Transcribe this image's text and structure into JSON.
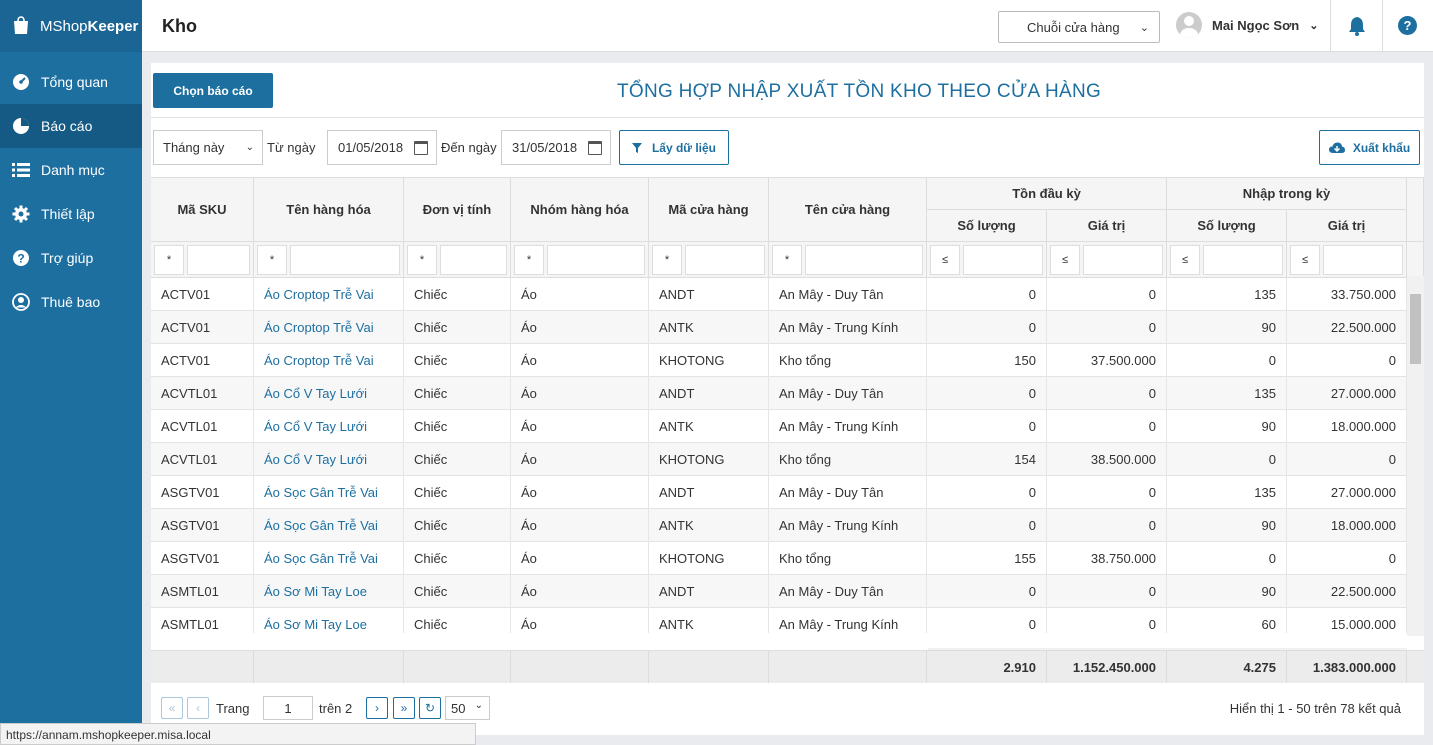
{
  "app": {
    "logo_text": "MShop",
    "logo_bold": "Keeper"
  },
  "sidebar": {
    "items": [
      {
        "label": "Tổng quan",
        "icon": "speedometer-icon"
      },
      {
        "label": "Báo cáo",
        "icon": "pie-chart-icon",
        "active": true
      },
      {
        "label": "Danh mục",
        "icon": "list-icon"
      },
      {
        "label": "Thiết lập",
        "icon": "gear-icon"
      },
      {
        "label": "Trợ giúp",
        "icon": "help-icon"
      },
      {
        "label": "Thuê bao",
        "icon": "user-icon"
      }
    ]
  },
  "header": {
    "title": "Kho",
    "store_select": "Chuỗi cửa hàng",
    "user_name": "Mai Ngọc Sơn"
  },
  "report": {
    "choose_button": "Chọn báo cáo",
    "title": "TỔNG HỢP NHẬP XUẤT TỒN KHO THEO CỬA HÀNG",
    "period": "Tháng này",
    "from_label": "Từ ngày",
    "from_date": "01/05/2018",
    "to_label": "Đến ngày",
    "to_date": "31/05/2018",
    "get_data_button": "Lấy dữ liệu",
    "export_button": "Xuất khẩu"
  },
  "table": {
    "columns": [
      "Mã SKU",
      "Tên hàng hóa",
      "Đơn vị tính",
      "Nhóm hàng hóa",
      "Mã cửa hàng",
      "Tên cửa hàng"
    ],
    "groups": [
      "Tồn đầu kỳ",
      "Nhập trong kỳ"
    ],
    "sub_columns": [
      "Số lượng",
      "Giá trị",
      "Số lượng",
      "Giá trị"
    ],
    "filter_ops": [
      "*",
      "*",
      "*",
      "*",
      "*",
      "*",
      "≤",
      "≤",
      "≤",
      "≤"
    ],
    "rows": [
      [
        "ACTV01",
        "Áo Croptop Trễ Vai",
        "Chiếc",
        "Áo",
        "ANDT",
        "An Mây - Duy Tân",
        "0",
        "0",
        "135",
        "33.750.000"
      ],
      [
        "ACTV01",
        "Áo Croptop Trễ Vai",
        "Chiếc",
        "Áo",
        "ANTK",
        "An Mây - Trung Kính",
        "0",
        "0",
        "90",
        "22.500.000"
      ],
      [
        "ACTV01",
        "Áo Croptop Trễ Vai",
        "Chiếc",
        "Áo",
        "KHOTONG",
        "Kho tổng",
        "150",
        "37.500.000",
        "0",
        "0"
      ],
      [
        "ACVTL01",
        "Áo Cổ V Tay Lưới",
        "Chiếc",
        "Áo",
        "ANDT",
        "An Mây - Duy Tân",
        "0",
        "0",
        "135",
        "27.000.000"
      ],
      [
        "ACVTL01",
        "Áo Cổ V Tay Lưới",
        "Chiếc",
        "Áo",
        "ANTK",
        "An Mây - Trung Kính",
        "0",
        "0",
        "90",
        "18.000.000"
      ],
      [
        "ACVTL01",
        "Áo Cổ V Tay Lưới",
        "Chiếc",
        "Áo",
        "KHOTONG",
        "Kho tổng",
        "154",
        "38.500.000",
        "0",
        "0"
      ],
      [
        "ASGTV01",
        "Áo Sọc Gân Trễ Vai",
        "Chiếc",
        "Áo",
        "ANDT",
        "An Mây - Duy Tân",
        "0",
        "0",
        "135",
        "27.000.000"
      ],
      [
        "ASGTV01",
        "Áo Sọc Gân Trễ Vai",
        "Chiếc",
        "Áo",
        "ANTK",
        "An Mây - Trung Kính",
        "0",
        "0",
        "90",
        "18.000.000"
      ],
      [
        "ASGTV01",
        "Áo Sọc Gân Trễ Vai",
        "Chiếc",
        "Áo",
        "KHOTONG",
        "Kho tổng",
        "155",
        "38.750.000",
        "0",
        "0"
      ],
      [
        "ASMTL01",
        "Áo Sơ Mi Tay Loe",
        "Chiếc",
        "Áo",
        "ANDT",
        "An Mây - Duy Tân",
        "0",
        "0",
        "90",
        "22.500.000"
      ],
      [
        "ASMTL01",
        "Áo Sơ Mi Tay Loe",
        "Chiếc",
        "Áo",
        "ANTK",
        "An Mây - Trung Kính",
        "0",
        "0",
        "60",
        "15.000.000"
      ]
    ],
    "totals": [
      "2.910",
      "1.152.450.000",
      "4.275",
      "1.383.000.000"
    ]
  },
  "pager": {
    "page_label": "Trang",
    "page": "1",
    "of_label": "trên 2",
    "page_size": "50",
    "summary": "Hiển thị 1 - 50 trên 78 kết quả"
  },
  "status_bar": {
    "url": "https://annam.mshopkeeper.misa.local"
  },
  "colors": {
    "brand": "#1d6fa0",
    "link": "#1d6fa0"
  }
}
